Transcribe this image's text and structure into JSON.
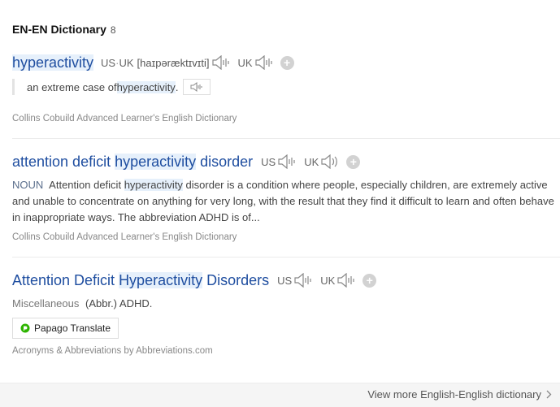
{
  "section": {
    "title": "EN-EN Dictionary",
    "count": "8"
  },
  "entries": [
    {
      "term_parts": [
        "",
        "hyperactivity",
        ""
      ],
      "us_label": "US",
      "sep": "·",
      "uk_label_1": "UK",
      "pronunciation": "[haɪpəræktɪvɪti]",
      "uk_label_2": "UK",
      "example_before": "an extreme case of ",
      "example_highlight": "hyperactivity",
      "example_after": ".",
      "source": "Collins Cobuild Advanced Learner's English Dictionary"
    },
    {
      "term_parts": [
        "attention deficit ",
        "hyperactivity",
        " disorder"
      ],
      "us_label": "US",
      "uk_label": "UK",
      "pos": "NOUN",
      "def_before": " Attention deficit ",
      "def_highlight": "hyperactivity",
      "def_after": " disorder is a condition where people, especially children, are extremely active and unable to concentrate on anything for very long, with the result that they find it difficult to learn and often behave in inappropriate ways. The abbreviation ADHD is of...",
      "source": "Collins Cobuild Advanced Learner's English Dictionary"
    },
    {
      "term_parts": [
        "Attention Deficit ",
        "Hyperactivity",
        " Disorders"
      ],
      "us_label": "US",
      "uk_label": "UK",
      "misc_label": "Miscellaneous",
      "misc_value": "(Abbr.) ADHD.",
      "papago_label": "Papago Translate",
      "source": "Acronyms & Abbreviations by Abbreviations.com"
    }
  ],
  "footer": {
    "more_label": "View more English-English dictionary"
  },
  "colors": {
    "term": "#1f4ea0",
    "highlight": "#e6f0fb",
    "papago_green": "#2db400"
  },
  "icons": [
    "speaker-icon",
    "add-icon",
    "papago-icon",
    "chevron-right-icon"
  ]
}
